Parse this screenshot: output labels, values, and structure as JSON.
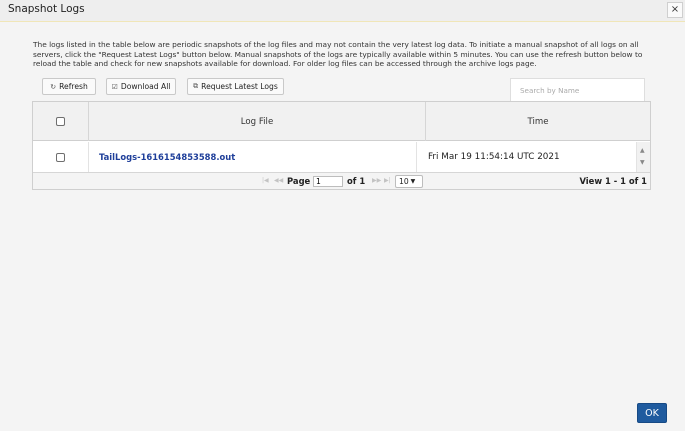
{
  "dialog": {
    "title": "Snapshot Logs",
    "close_glyph": "×"
  },
  "description": "The logs listed in the table below are periodic snapshots of the log files and may not contain the very latest log data. To initiate a manual snapshot of all logs on all servers, click the \"Request Latest Logs\" button below. Manual snapshots of the logs are typically available within 5 minutes. You can use the refresh button below to reload the table and check for new snapshots available for download. For older log files can be accessed through the archive logs page.",
  "toolbar": {
    "refresh_label": "Refresh",
    "refresh_icon": "refresh-icon",
    "download_all_label": "Download All",
    "download_icon": "checkbox-icon",
    "request_latest_label": "Request Latest Logs",
    "request_icon": "copy-icon"
  },
  "search": {
    "placeholder": "Search by Name",
    "value": ""
  },
  "table": {
    "columns": [
      "Log File",
      "Time"
    ],
    "rows": [
      {
        "file": "TailLogs-1616154853588.out",
        "time": "Fri Mar 19 11:54:14 UTC 2021"
      }
    ]
  },
  "pager": {
    "page_label": "Page",
    "current_page": "1",
    "of_label": "of 1",
    "page_size": "10",
    "view_text": "View 1 - 1 of 1"
  },
  "footer": {
    "ok_label": "OK",
    "ok_color": "#1f5b9f"
  }
}
